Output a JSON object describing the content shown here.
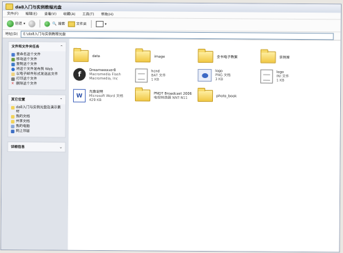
{
  "window": {
    "title": "da8入门与实例教程光盘"
  },
  "menu": [
    "文件(F)",
    "编辑(E)",
    "查看(V)",
    "收藏(A)",
    "工具(T)",
    "帮助(H)"
  ],
  "toolbar": {
    "back": "后退",
    "search": "搜索",
    "folders": "文件夹"
  },
  "address": {
    "label": "地址(D)",
    "path": "E:\\da8入门与实例教程光盘"
  },
  "sidebar": {
    "tasks_title": "文件和文件夹任务",
    "tasks": [
      "重命名这个文件",
      "移动这个文件",
      "复制这个文件",
      "将这个文件发布到 Web",
      "以电子邮件形式发送此文件",
      "打印这个文件",
      "删除这个文件"
    ],
    "places_title": "其它位置",
    "places": [
      "da8入门与实例光盘及演示素材",
      "我的文档",
      "共享文档",
      "我的电脑",
      "网上邻居"
    ],
    "details_title": "详细信息"
  },
  "files": [
    {
      "name": "data",
      "type": "folder"
    },
    {
      "name": "image",
      "type": "folder"
    },
    {
      "name": "全书电子教案",
      "type": "folder"
    },
    {
      "name": "实例库",
      "type": "folder"
    },
    {
      "name": "Dreamweaver8",
      "desc": "Macromedia Flash",
      "size": "Macromedia, Inc",
      "type": "flash"
    },
    {
      "name": "hcnd",
      "desc": "BAT 文件",
      "size": "1 KB",
      "type": "bat"
    },
    {
      "name": "logo",
      "desc": "PNG 文档",
      "size": "3 KB",
      "type": "png"
    },
    {
      "name": "logo",
      "desc": "INI 文件",
      "size": "1 KB",
      "type": "ini"
    },
    {
      "name": "光盘说明",
      "desc": "Microsoft Word 文档",
      "size": "429 KB",
      "type": "word"
    },
    {
      "name": "PNDT Broadcast 2006",
      "desc": "电视转换器 NNT-N11",
      "size": "",
      "type": "folder"
    },
    {
      "name": "photo_book",
      "type": "folder"
    }
  ]
}
